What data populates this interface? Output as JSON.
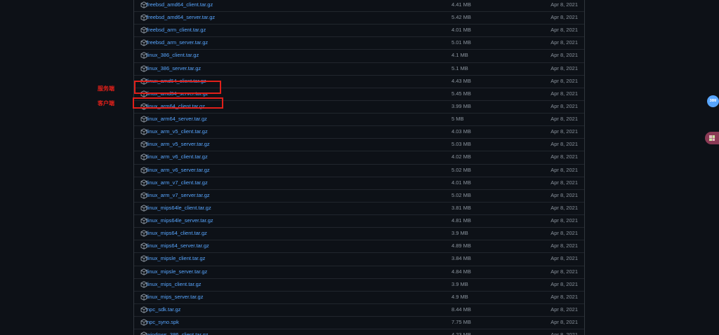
{
  "assets": [
    {
      "name": "freebsd_amd64_client.tar.gz",
      "size": "4.41 MB",
      "date": "Apr 8, 2021"
    },
    {
      "name": "freebsd_amd64_server.tar.gz",
      "size": "5.42 MB",
      "date": "Apr 8, 2021"
    },
    {
      "name": "freebsd_arm_client.tar.gz",
      "size": "4.01 MB",
      "date": "Apr 8, 2021"
    },
    {
      "name": "freebsd_arm_server.tar.gz",
      "size": "5.01 MB",
      "date": "Apr 8, 2021"
    },
    {
      "name": "linux_386_client.tar.gz",
      "size": "4.1 MB",
      "date": "Apr 8, 2021"
    },
    {
      "name": "linux_386_server.tar.gz",
      "size": "5.1 MB",
      "date": "Apr 8, 2021"
    },
    {
      "name": "linux_amd64_client.tar.gz",
      "size": "4.43 MB",
      "date": "Apr 8, 2021"
    },
    {
      "name": "linux_amd64_server.tar.gz",
      "size": "5.45 MB",
      "date": "Apr 8, 2021"
    },
    {
      "name": "linux_arm64_client.tar.gz",
      "size": "3.99 MB",
      "date": "Apr 8, 2021"
    },
    {
      "name": "linux_arm64_server.tar.gz",
      "size": "5 MB",
      "date": "Apr 8, 2021"
    },
    {
      "name": "linux_arm_v5_client.tar.gz",
      "size": "4.03 MB",
      "date": "Apr 8, 2021"
    },
    {
      "name": "linux_arm_v5_server.tar.gz",
      "size": "5.03 MB",
      "date": "Apr 8, 2021"
    },
    {
      "name": "linux_arm_v6_client.tar.gz",
      "size": "4.02 MB",
      "date": "Apr 8, 2021"
    },
    {
      "name": "linux_arm_v6_server.tar.gz",
      "size": "5.02 MB",
      "date": "Apr 8, 2021"
    },
    {
      "name": "linux_arm_v7_client.tar.gz",
      "size": "4.01 MB",
      "date": "Apr 8, 2021"
    },
    {
      "name": "linux_arm_v7_server.tar.gz",
      "size": "5.02 MB",
      "date": "Apr 8, 2021"
    },
    {
      "name": "linux_mips64le_client.tar.gz",
      "size": "3.81 MB",
      "date": "Apr 8, 2021"
    },
    {
      "name": "linux_mips64le_server.tar.gz",
      "size": "4.81 MB",
      "date": "Apr 8, 2021"
    },
    {
      "name": "linux_mips64_client.tar.gz",
      "size": "3.9 MB",
      "date": "Apr 8, 2021"
    },
    {
      "name": "linux_mips64_server.tar.gz",
      "size": "4.89 MB",
      "date": "Apr 8, 2021"
    },
    {
      "name": "linux_mipsle_client.tar.gz",
      "size": "3.84 MB",
      "date": "Apr 8, 2021"
    },
    {
      "name": "linux_mipsle_server.tar.gz",
      "size": "4.84 MB",
      "date": "Apr 8, 2021"
    },
    {
      "name": "linux_mips_client.tar.gz",
      "size": "3.9 MB",
      "date": "Apr 8, 2021"
    },
    {
      "name": "linux_mips_server.tar.gz",
      "size": "4.9 MB",
      "date": "Apr 8, 2021"
    },
    {
      "name": "npc_sdk.tar.gz",
      "size": "8.44 MB",
      "date": "Apr 8, 2021"
    },
    {
      "name": "npc_syno.spk",
      "size": "7.75 MB",
      "date": "Apr 8, 2021"
    },
    {
      "name": "windows_386_client.tar.gz",
      "size": "4.23 MB",
      "date": "Apr 8, 2021"
    }
  ],
  "annotations": {
    "server_label": "服务端",
    "client_label": "客户端"
  },
  "floating": {
    "badge_text": "38M",
    "tool_icon": "puzzle-icon"
  },
  "colors": {
    "link": "#58a6ff",
    "muted": "#8b949e",
    "background": "#0d1117",
    "highlight": "#e0201a"
  }
}
